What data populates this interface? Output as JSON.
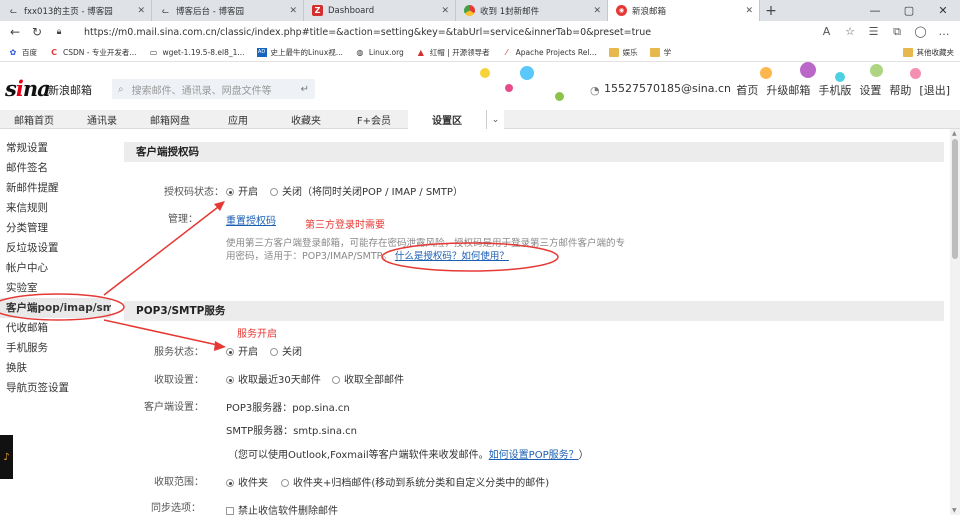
{
  "browser": {
    "tabs": [
      {
        "title": "fxx013的主页 - 博客园",
        "icon": "blog-icon"
      },
      {
        "title": "博客后台 - 博客园",
        "icon": "blog-icon"
      },
      {
        "title": "Dashboard",
        "icon": "z-icon"
      },
      {
        "title": "收到 1封新邮件",
        "icon": "chrome-icon"
      },
      {
        "title": "新浪邮箱",
        "icon": "sina-icon"
      }
    ],
    "url": "https://m0.mail.sina.com.cn/classic/index.php#title=&action=setting&key=&tabUrl=service&innerTab=0&preset=true",
    "bookmarks": [
      "百度",
      "CSDN - 专业开发者...",
      "wget-1.19.5-8.el8_1...",
      "史上最牛的Linux视...",
      "Linux.org",
      "红帽 | 开源领导者",
      "Apache Projects Rel...",
      "娱乐",
      "学"
    ],
    "bookmarks_other": "其他收藏夹"
  },
  "header": {
    "logo": "sina",
    "logo_text": "新浪邮箱",
    "search_placeholder": "搜索邮件、通讯录、网盘文件等",
    "account": "15527570185@sina.cn",
    "nav": [
      "首页",
      "升级邮箱",
      "手机版",
      "设置",
      "帮助",
      "[退出]"
    ]
  },
  "main_tabs": [
    "邮箱首页",
    "通讯录",
    "邮箱网盘",
    "应用",
    "收藏夹",
    "F+会员",
    "设置区"
  ],
  "sidebar": [
    "常规设置",
    "邮件签名",
    "新邮件提醒",
    "来信规则",
    "分类管理",
    "反垃圾设置",
    "帐户中心",
    "实验室",
    "客户端pop/imap/smtp",
    "代收邮箱",
    "手机服务",
    "换肤",
    "导航页签设置"
  ],
  "auth_section": {
    "title": "客户端授权码",
    "status_label": "授权码状态：",
    "on": "开启",
    "off": "关闭（将同时关闭POP / IMAP / SMTP）",
    "manage_label": "管理：",
    "reset_link": "重置授权码",
    "annotation": "第三方登录时需要",
    "note_line1": "使用第三方客户端登录邮箱，可能存在密码泄露风险，授权码是用于登录第三方邮件客户端的专",
    "note_line2": "用密码，适用于：POP3/IMAP/SMTP。",
    "help_link": "什么是授权码？如何使用？"
  },
  "pop_section": {
    "title": "POP3/SMTP服务",
    "annotation": "服务开启",
    "status_label": "服务状态：",
    "on": "开启",
    "off": "关闭",
    "receive_label": "收取设置：",
    "receive_opt1": "收取最近30天邮件",
    "receive_opt2": "收取全部邮件",
    "client_label": "客户端设置：",
    "pop3_server": "POP3服务器：pop.sina.cn",
    "smtp_server": "SMTP服务器：smtp.sina.cn",
    "client_note": "（您可以使用Outlook,Foxmail等客户端软件来收发邮件。",
    "client_link": "如何设置POP服务？",
    "client_note_end": "）",
    "range_label": "收取范围：",
    "range_opt1": "收件夹",
    "range_opt2": "收件夹+归档邮件(移动到系统分类和自定义分类中的邮件)",
    "sync_label": "同步选项：",
    "sync_opt": "禁止收信软件删除邮件"
  },
  "colors": {
    "annotation": "#e53935",
    "link": "#1a5fb4",
    "section_bg": "#ececec"
  }
}
